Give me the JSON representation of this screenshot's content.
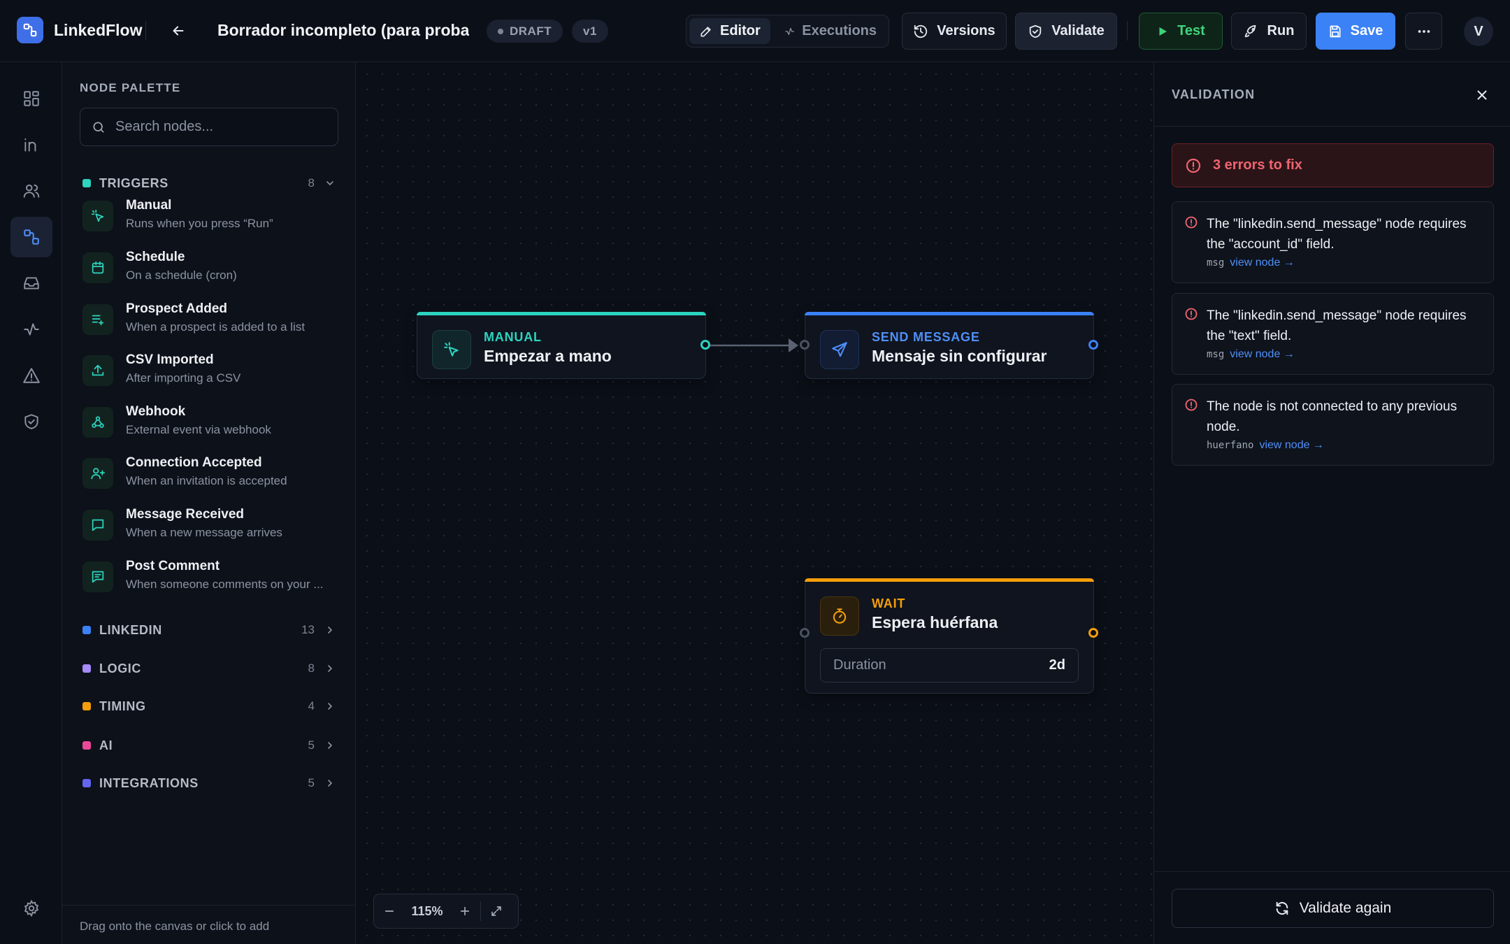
{
  "app": {
    "name": "LinkedFlow"
  },
  "header": {
    "workflow_title": "Borrador incompleto (para probar la validación)",
    "status_badge": "DRAFT",
    "version_badge": "v1",
    "tabs": [
      {
        "label": "Editor",
        "icon": "pencil-icon",
        "active": true
      },
      {
        "label": "Executions",
        "icon": "activity-icon",
        "active": false
      }
    ],
    "buttons": {
      "versions": "Versions",
      "validate": "Validate",
      "test": "Test",
      "run": "Run",
      "save": "Save"
    },
    "avatar_initial": "V"
  },
  "rail": {
    "items": [
      {
        "icon": "dashboard-icon"
      },
      {
        "icon": "linkedin-icon"
      },
      {
        "icon": "users-icon"
      },
      {
        "icon": "workflow-icon",
        "active": true
      },
      {
        "icon": "inbox-icon"
      },
      {
        "icon": "activity-icon"
      },
      {
        "icon": "alert-triangle-icon"
      },
      {
        "icon": "shield-check-icon"
      }
    ],
    "bottom_icon": "settings-gear-icon"
  },
  "palette": {
    "title": "NODE PALETTE",
    "search_placeholder": "Search nodes...",
    "categories": [
      {
        "name": "TRIGGERS",
        "count": "8",
        "color": "#2dd4bf",
        "expanded": true,
        "items": [
          {
            "name": "Manual",
            "desc": "Runs when you press “Run”",
            "icon": "cursor-click-icon"
          },
          {
            "name": "Schedule",
            "desc": "On a schedule (cron)",
            "icon": "calendar-icon"
          },
          {
            "name": "Prospect Added",
            "desc": "When a prospect is added to a list",
            "icon": "list-plus-icon"
          },
          {
            "name": "CSV Imported",
            "desc": "After importing a CSV",
            "icon": "upload-icon"
          },
          {
            "name": "Webhook",
            "desc": "External event via webhook",
            "icon": "webhook-icon"
          },
          {
            "name": "Connection Accepted",
            "desc": "When an invitation is accepted",
            "icon": "user-plus-icon"
          },
          {
            "name": "Message Received",
            "desc": "When a new message arrives",
            "icon": "message-square-icon"
          },
          {
            "name": "Post Comment",
            "desc": "When someone comments on your ...",
            "icon": "message-text-icon"
          }
        ]
      },
      {
        "name": "LINKEDIN",
        "count": "13",
        "color": "#3b82f6",
        "expanded": false
      },
      {
        "name": "LOGIC",
        "count": "8",
        "color": "#a78bfa",
        "expanded": false
      },
      {
        "name": "TIMING",
        "count": "4",
        "color": "#f59e0b",
        "expanded": false
      },
      {
        "name": "AI",
        "count": "5",
        "color": "#ec4899",
        "expanded": false
      },
      {
        "name": "INTEGRATIONS",
        "count": "5",
        "color": "#6366f1",
        "expanded": false
      }
    ],
    "footer_hint": "Drag onto the canvas or click to add"
  },
  "canvas": {
    "zoom": "115%",
    "nodes": [
      {
        "kind": "MANUAL",
        "title": "Empezar a mano",
        "color": "#2dd4bf",
        "icon": "cursor-click-icon"
      },
      {
        "kind": "SEND MESSAGE",
        "title": "Mensaje sin configurar",
        "color": "#3b82f6",
        "icon": "send-icon"
      },
      {
        "kind": "WAIT",
        "title": "Espera huérfana",
        "color": "#f59e0b",
        "icon": "timer-icon",
        "param_label": "Duration",
        "param_value": "2d"
      }
    ]
  },
  "validation": {
    "title": "VALIDATION",
    "summary": "3 errors to fix",
    "errors": [
      {
        "message": "The \"linkedin.send_message\" node requires the \"account_id\" field.",
        "node_id": "msg",
        "link": "view node →"
      },
      {
        "message": "The \"linkedin.send_message\" node requires the \"text\" field.",
        "node_id": "msg",
        "link": "view node →"
      },
      {
        "message": "The node is not connected to any previous node.",
        "node_id": "huerfano",
        "link": "view node →"
      }
    ],
    "revalidate_label": "Validate again"
  }
}
